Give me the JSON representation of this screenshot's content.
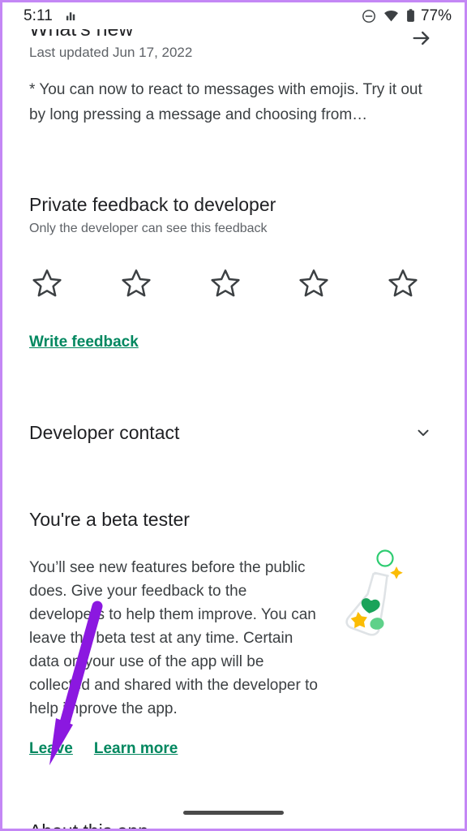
{
  "status_bar": {
    "time": "5:11",
    "signal_icon": "signal-bars-icon",
    "dnd_icon": "do-not-disturb-icon",
    "wifi_icon": "wifi-icon",
    "battery_icon": "battery-icon",
    "battery_percent": "77%"
  },
  "whats_new": {
    "title": "What's new",
    "last_updated": "Last updated Jun 17, 2022",
    "arrow_icon": "arrow-right-icon",
    "body": "* You can now to react to messages with emojis. Try it out by long pressing a message and choosing from…"
  },
  "private_feedback": {
    "title": "Private feedback to developer",
    "subtitle": "Only the developer can see this feedback",
    "rating_value": 0,
    "rating_max": 5,
    "star_icon": "star-outline-icon",
    "write_feedback_label": "Write feedback"
  },
  "developer_contact": {
    "title": "Developer contact",
    "expand_icon": "chevron-down-icon"
  },
  "beta_tester": {
    "title": "You're a beta tester",
    "body": "You’ll see new features before the public does. Give your feedback to the developers to help them improve. You can leave the beta test at any time. Certain data on your use of the app will be collected and shared with the developer to help improve the app.",
    "illustration_icon": "beta-flask-illustration",
    "leave_label": "Leave",
    "learn_more_label": "Learn more"
  },
  "about_section": {
    "title": "About this app"
  },
  "nav_bar": {
    "home_indicator": "home-indicator-pill"
  },
  "annotation": {
    "arrow_icon": "annotation-arrow-icon",
    "color": "#8b18e0"
  },
  "colors": {
    "link_green": "#01875f",
    "text_primary": "#202124",
    "text_secondary": "#5f6368",
    "frame_purple": "#c487f5",
    "annotation_purple": "#8b18e0"
  }
}
